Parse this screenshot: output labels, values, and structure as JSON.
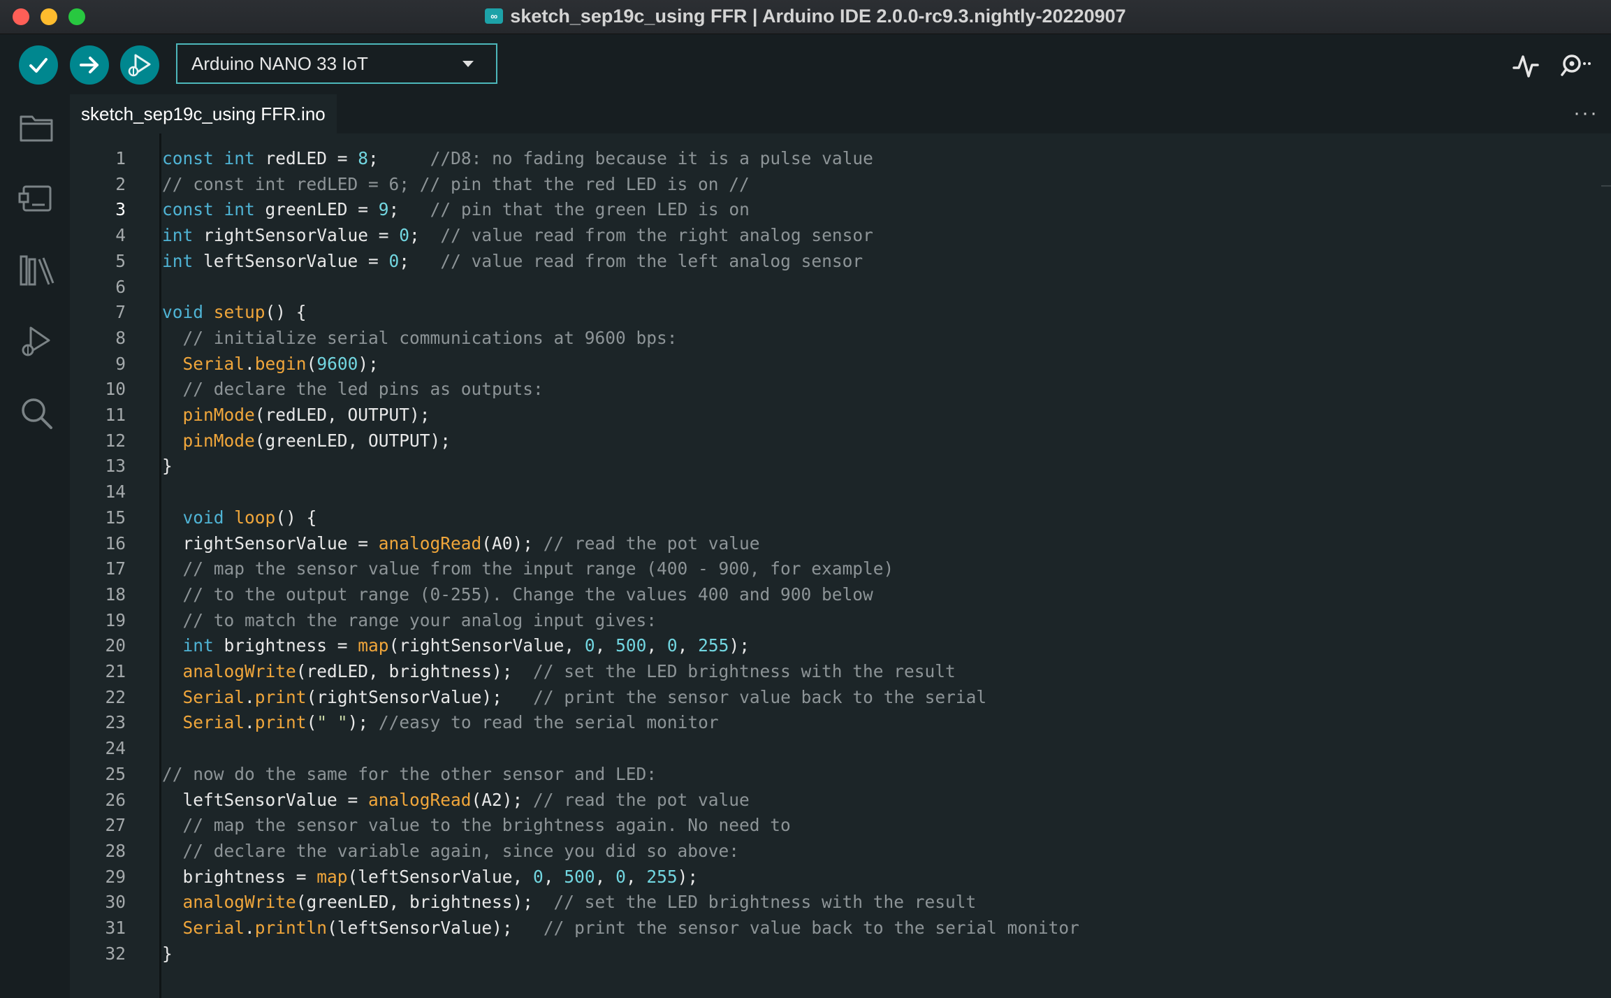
{
  "window": {
    "title": "sketch_sep19c_using FFR | Arduino IDE 2.0.0-rc9.3.nightly-20220907",
    "app_icon": "arduino-infinity-icon"
  },
  "toolbar": {
    "verify_icon": "checkmark-icon",
    "upload_icon": "arrow-right-icon",
    "debug_icon": "debug-play-icon",
    "board": "Arduino NANO 33 IoT",
    "serial_plotter_icon": "serial-plotter-icon",
    "serial_monitor_icon": "serial-monitor-icon"
  },
  "activity_bar": {
    "items": [
      "folder-icon",
      "board-manager-icon",
      "library-icon",
      "debug-icon",
      "search-icon"
    ]
  },
  "editor": {
    "tab_label": "sketch_sep19c_using FFR.ino",
    "more_label": "···",
    "current_line": 3,
    "lines": [
      [
        [
          "kw",
          "const int"
        ],
        [
          "t",
          " redLED = "
        ],
        [
          "num",
          "8"
        ],
        [
          "t",
          ";     "
        ],
        [
          "cm",
          "//D8: no fading because it is a pulse value"
        ]
      ],
      [
        [
          "cm",
          "// const int redLED = 6; // pin that the red LED is on //"
        ]
      ],
      [
        [
          "kw",
          "const int"
        ],
        [
          "t",
          " greenLED = "
        ],
        [
          "num",
          "9"
        ],
        [
          "t",
          ";   "
        ],
        [
          "cm",
          "// pin that the green LED is on"
        ]
      ],
      [
        [
          "kw",
          "int"
        ],
        [
          "t",
          " rightSensorValue = "
        ],
        [
          "num",
          "0"
        ],
        [
          "t",
          ";  "
        ],
        [
          "cm",
          "// value read from the right analog sensor"
        ]
      ],
      [
        [
          "kw",
          "int"
        ],
        [
          "t",
          " leftSensorValue = "
        ],
        [
          "num",
          "0"
        ],
        [
          "t",
          ";   "
        ],
        [
          "cm",
          "// value read from the left analog sensor"
        ]
      ],
      [],
      [
        [
          "kw",
          "void"
        ],
        [
          "t",
          " "
        ],
        [
          "fn",
          "setup"
        ],
        [
          "t",
          "() {"
        ]
      ],
      [
        [
          "t",
          "  "
        ],
        [
          "cm",
          "// initialize serial communications at 9600 bps:"
        ]
      ],
      [
        [
          "t",
          "  "
        ],
        [
          "fn",
          "Serial"
        ],
        [
          "t",
          "."
        ],
        [
          "fn",
          "begin"
        ],
        [
          "t",
          "("
        ],
        [
          "num",
          "9600"
        ],
        [
          "t",
          ");"
        ]
      ],
      [
        [
          "t",
          "  "
        ],
        [
          "cm",
          "// declare the led pins as outputs:"
        ]
      ],
      [
        [
          "t",
          "  "
        ],
        [
          "fn",
          "pinMode"
        ],
        [
          "t",
          "(redLED, OUTPUT);"
        ]
      ],
      [
        [
          "t",
          "  "
        ],
        [
          "fn",
          "pinMode"
        ],
        [
          "t",
          "(greenLED, OUTPUT);"
        ]
      ],
      [
        [
          "t",
          "}"
        ]
      ],
      [],
      [
        [
          "t",
          "  "
        ],
        [
          "kw",
          "void"
        ],
        [
          "t",
          " "
        ],
        [
          "fn",
          "loop"
        ],
        [
          "t",
          "() {"
        ]
      ],
      [
        [
          "t",
          "  rightSensorValue = "
        ],
        [
          "fn",
          "analogRead"
        ],
        [
          "t",
          "(A0); "
        ],
        [
          "cm",
          "// read the pot value"
        ]
      ],
      [
        [
          "t",
          "  "
        ],
        [
          "cm",
          "// map the sensor value from the input range (400 - 900, for example)"
        ]
      ],
      [
        [
          "t",
          "  "
        ],
        [
          "cm",
          "// to the output range (0-255). Change the values 400 and 900 below"
        ]
      ],
      [
        [
          "t",
          "  "
        ],
        [
          "cm",
          "// to match the range your analog input gives:"
        ]
      ],
      [
        [
          "t",
          "  "
        ],
        [
          "kw",
          "int"
        ],
        [
          "t",
          " brightness = "
        ],
        [
          "fn",
          "map"
        ],
        [
          "t",
          "(rightSensorValue, "
        ],
        [
          "num",
          "0"
        ],
        [
          "t",
          ", "
        ],
        [
          "num",
          "500"
        ],
        [
          "t",
          ", "
        ],
        [
          "num",
          "0"
        ],
        [
          "t",
          ", "
        ],
        [
          "num",
          "255"
        ],
        [
          "t",
          ");"
        ]
      ],
      [
        [
          "t",
          "  "
        ],
        [
          "fn",
          "analogWrite"
        ],
        [
          "t",
          "(redLED, brightness);  "
        ],
        [
          "cm",
          "// set the LED brightness with the result"
        ]
      ],
      [
        [
          "t",
          "  "
        ],
        [
          "fn",
          "Serial"
        ],
        [
          "t",
          "."
        ],
        [
          "fn",
          "print"
        ],
        [
          "t",
          "(rightSensorValue);   "
        ],
        [
          "cm",
          "// print the sensor value back to the serial"
        ]
      ],
      [
        [
          "t",
          "  "
        ],
        [
          "fn",
          "Serial"
        ],
        [
          "t",
          "."
        ],
        [
          "fn",
          "print"
        ],
        [
          "t",
          "("
        ],
        [
          "str",
          "\" \""
        ],
        [
          "t",
          "); "
        ],
        [
          "cm",
          "//easy to read the serial monitor"
        ]
      ],
      [],
      [
        [
          "cm",
          "// now do the same for the other sensor and LED:"
        ]
      ],
      [
        [
          "t",
          "  leftSensorValue = "
        ],
        [
          "fn",
          "analogRead"
        ],
        [
          "t",
          "(A2); "
        ],
        [
          "cm",
          "// read the pot value"
        ]
      ],
      [
        [
          "t",
          "  "
        ],
        [
          "cm",
          "// map the sensor value to the brightness again. No need to"
        ]
      ],
      [
        [
          "t",
          "  "
        ],
        [
          "cm",
          "// declare the variable again, since you did so above:"
        ]
      ],
      [
        [
          "t",
          "  brightness = "
        ],
        [
          "fn",
          "map"
        ],
        [
          "t",
          "(leftSensorValue, "
        ],
        [
          "num",
          "0"
        ],
        [
          "t",
          ", "
        ],
        [
          "num",
          "500"
        ],
        [
          "t",
          ", "
        ],
        [
          "num",
          "0"
        ],
        [
          "t",
          ", "
        ],
        [
          "num",
          "255"
        ],
        [
          "t",
          ");"
        ]
      ],
      [
        [
          "t",
          "  "
        ],
        [
          "fn",
          "analogWrite"
        ],
        [
          "t",
          "(greenLED, brightness);  "
        ],
        [
          "cm",
          "// set the LED brightness with the result"
        ]
      ],
      [
        [
          "t",
          "  "
        ],
        [
          "fn",
          "Serial"
        ],
        [
          "t",
          "."
        ],
        [
          "fn",
          "println"
        ],
        [
          "t",
          "(leftSensorValue);   "
        ],
        [
          "cm",
          "// print the sensor value back to the serial monitor"
        ]
      ],
      [
        [
          "t",
          "}"
        ]
      ]
    ]
  }
}
